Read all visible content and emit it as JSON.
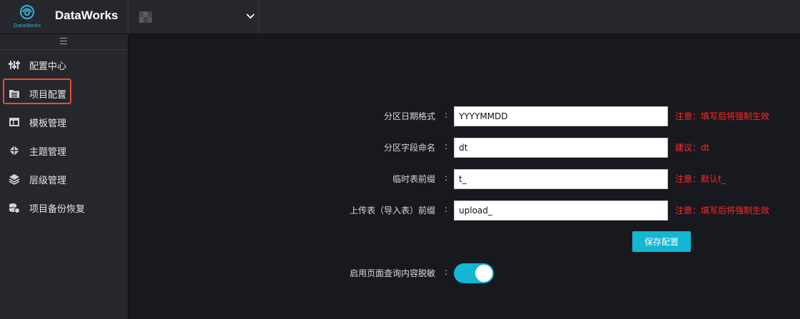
{
  "header": {
    "logo_sub": "DataWorks",
    "title": "DataWorks"
  },
  "sidebar": {
    "items": [
      {
        "label": "配置中心",
        "icon": "sliders-icon"
      },
      {
        "label": "项目配置",
        "icon": "folder-list-icon"
      },
      {
        "label": "模板管理",
        "icon": "template-icon"
      },
      {
        "label": "主题管理",
        "icon": "diamond-icon"
      },
      {
        "label": "层级管理",
        "icon": "layers-icon"
      },
      {
        "label": "项目备份恢复",
        "icon": "database-backup-icon"
      }
    ]
  },
  "form": {
    "colon": ":",
    "partition_date_format": {
      "label": "分区日期格式",
      "value": "YYYYMMDD",
      "note": "注意：填写后将强制生效"
    },
    "partition_field_name": {
      "label": "分区字段命名",
      "value": "dt",
      "note": "建议：dt"
    },
    "temp_table_prefix": {
      "label": "临时表前缀",
      "value": "t_",
      "note": "注意：默认t_"
    },
    "upload_table_prefix": {
      "label": "上传表（导入表）前缀",
      "value": "upload_",
      "note": "注意：填写后将强制生效"
    },
    "save_label": "保存配置",
    "desensitize": {
      "label": "启用页面查询内容脱敏",
      "enabled": true
    }
  },
  "colors": {
    "accent": "#13b6d3",
    "warning": "#ff2a2a",
    "highlight": "#e5502e"
  }
}
